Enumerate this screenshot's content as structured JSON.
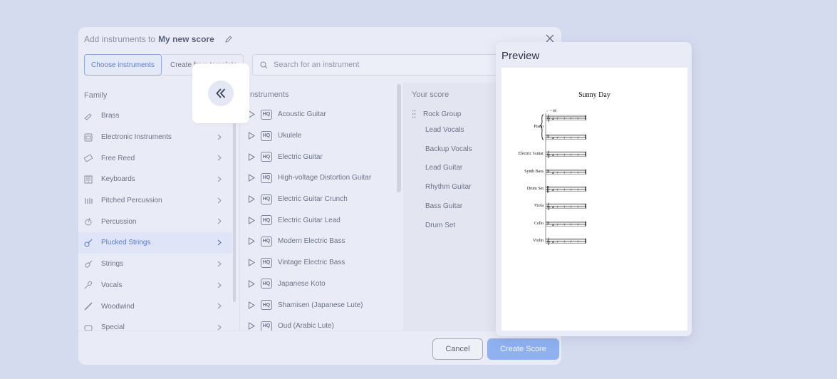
{
  "dialog": {
    "title_prefix": "Add instruments to",
    "score_name": "My new score",
    "tabs": [
      "Choose instruments",
      "Create from template"
    ],
    "search_placeholder": "Search for an instrument"
  },
  "family": {
    "heading": "Family",
    "items": [
      {
        "label": "Brass",
        "icon": "trumpet-icon"
      },
      {
        "label": "Electronic Instruments",
        "icon": "synth-icon"
      },
      {
        "label": "Free Reed",
        "icon": "harmonica-icon"
      },
      {
        "label": "Keyboards",
        "icon": "keyboard-icon"
      },
      {
        "label": "Pitched Percussion",
        "icon": "xylophone-icon"
      },
      {
        "label": "Percussion",
        "icon": "drum-icon"
      },
      {
        "label": "Plucked Strings",
        "icon": "guitar-icon",
        "active": true
      },
      {
        "label": "Strings",
        "icon": "violin-icon"
      },
      {
        "label": "Vocals",
        "icon": "microphone-icon"
      },
      {
        "label": "Woodwind",
        "icon": "flute-icon"
      },
      {
        "label": "Special",
        "icon": "special-icon"
      }
    ]
  },
  "instruments": {
    "heading": "Instruments",
    "hq_badge": "HQ",
    "items": [
      "Acoustic Guitar",
      "Ukulele",
      "Electric Guitar",
      "High-voltage Distortion Guitar",
      "Electric Guitar Crunch",
      "Electric Guitar Lead",
      "Modern Electric Bass",
      "Vintage Electric Bass",
      "Japanese Koto",
      "Shamisen (Japanese Lute)",
      "Oud (Arabic Lute)"
    ]
  },
  "your_score": {
    "heading": "Your score",
    "group": "Rock Group",
    "items": [
      "Lead Vocals",
      "Backup Vocals",
      "Lead Guitar",
      "Rhythm Guitar",
      "Bass Guitar",
      "Drum Set"
    ]
  },
  "buttons": {
    "cancel": "Cancel",
    "create": "Create Score"
  },
  "preview": {
    "title": "Preview",
    "song_title": "Sunny Day",
    "tempo": "♩= 80",
    "staves": [
      "Piano",
      "Electric Guitar",
      "Synth Bass",
      "Drum Set",
      "Viola",
      "Cello",
      "Violin"
    ]
  },
  "colors": {
    "background": "#d5dbef",
    "accent": "#5f7fd3",
    "primary_button": "#8fb1f0"
  }
}
